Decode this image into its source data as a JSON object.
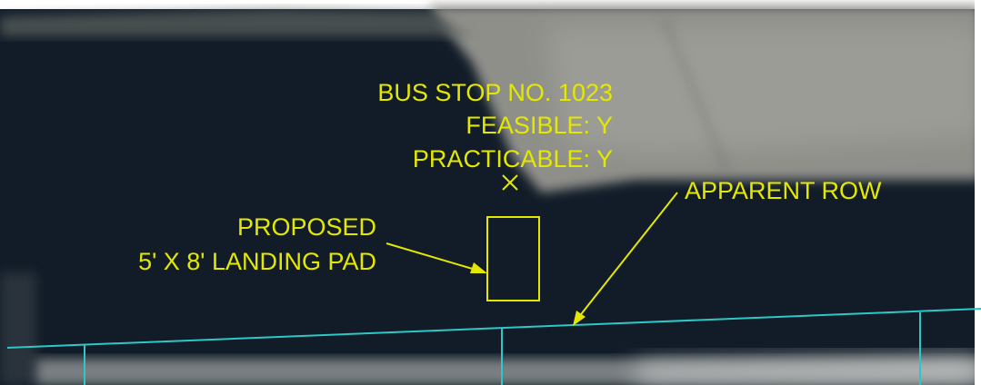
{
  "colors": {
    "annotation": "#e4e800",
    "row_line": "#2ec6c6",
    "pavement": "#0f1a26",
    "concrete": "#9a9994"
  },
  "bus_stop": {
    "title": "BUS STOP NO. 1023",
    "feasible": "FEASIBLE: Y",
    "practicable": "PRACTICABLE: Y"
  },
  "landing_pad": {
    "line1": "PROPOSED",
    "line2": "5' X 8' LANDING PAD"
  },
  "row_label": "APPARENT ROW"
}
